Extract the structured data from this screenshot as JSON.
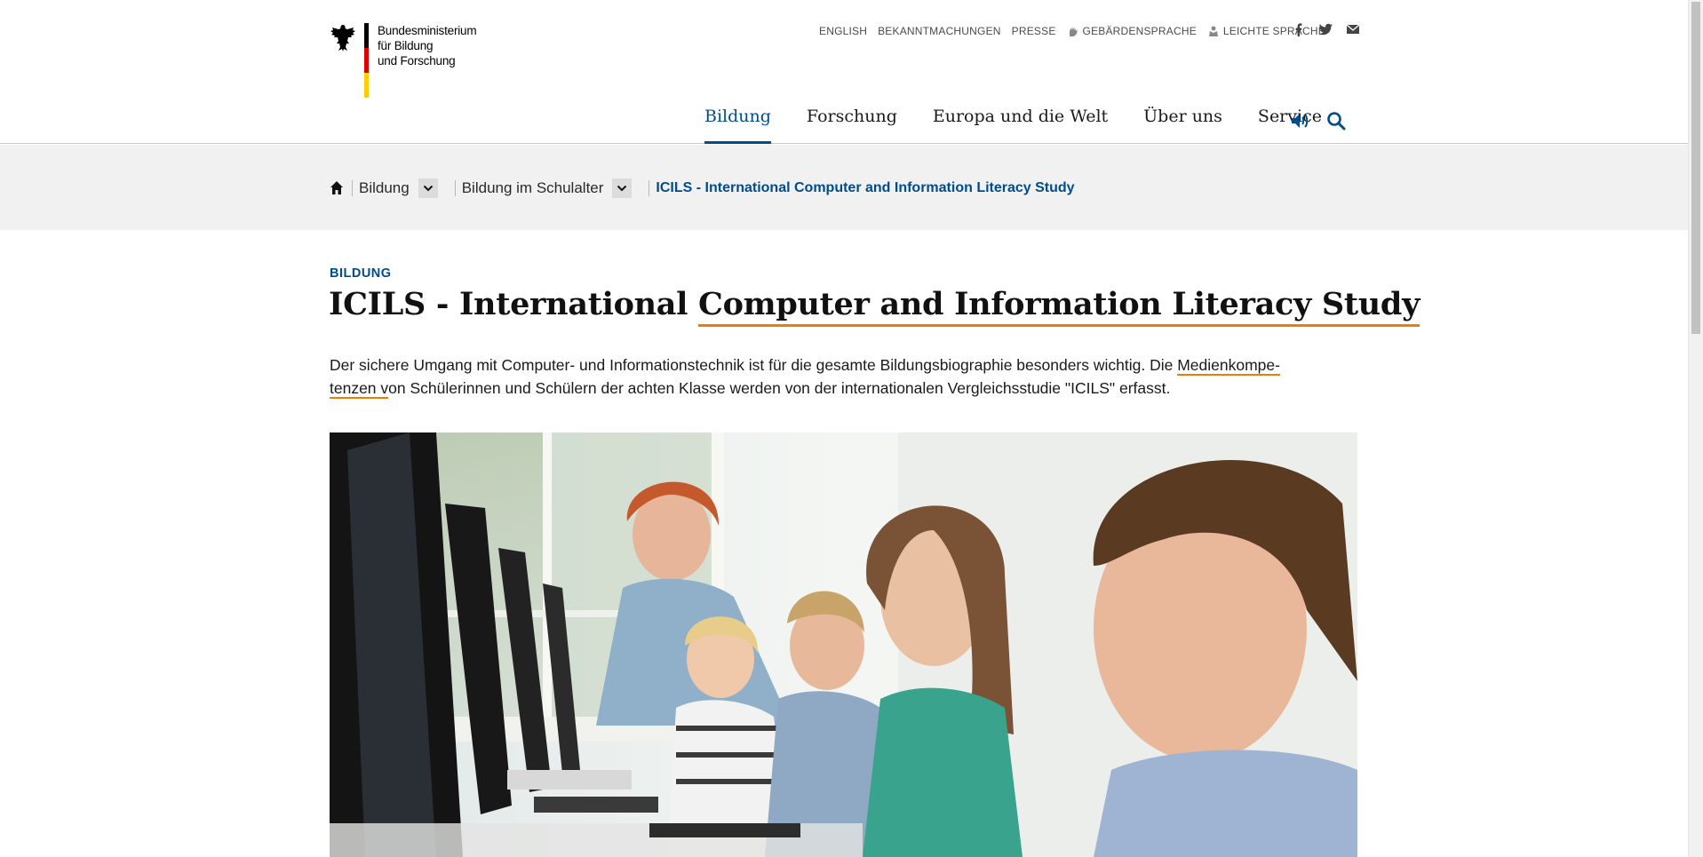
{
  "header": {
    "logo": {
      "lines": [
        "Bundesministerium",
        "für Bildung",
        "und Forschung"
      ]
    },
    "meta_nav": [
      {
        "label": "ENGLISH",
        "icon": ""
      },
      {
        "label": "BEKANNTMACHUNGEN",
        "icon": ""
      },
      {
        "label": "PRESSE",
        "icon": ""
      },
      {
        "label": "GEBÄRDENSPRACHE",
        "icon": "sign-language-icon"
      },
      {
        "label": "LEICHTE SPRACHE",
        "icon": "easy-language-icon"
      }
    ],
    "social": [
      "facebook-icon",
      "twitter-icon",
      "mail-icon"
    ],
    "main_nav": [
      {
        "label": "Bildung",
        "active": true
      },
      {
        "label": "Forschung",
        "active": false
      },
      {
        "label": "Europa und die Welt",
        "active": false
      },
      {
        "label": "Über uns",
        "active": false
      },
      {
        "label": "Service",
        "active": false
      }
    ],
    "tools": [
      "speaker-icon",
      "search-icon"
    ]
  },
  "breadcrumb": {
    "home_icon": "home-icon",
    "items": [
      "Bildung",
      "Bildung im Schulalter"
    ],
    "current": "ICILS - International Computer and Information Literacy Study"
  },
  "article": {
    "kicker": "BILDUNG",
    "title_part1": "ICILS - International ",
    "title_part2": "Computer and Information Literacy Study",
    "lead_part1": "Der sichere Umgang mit Computer- und Informationstechnik ist für die gesamte Bildungsbiographie besonders wichtig. Die ",
    "lead_link_a": "Medienkompe-",
    "lead_link_b": "tenzen v",
    "lead_part2": "on Schülerinnen und Schülern der achten Klasse werden von der internationalen Vergleichsstudie \"ICILS\" erfasst."
  },
  "colors": {
    "accent_blue": "#004c8c",
    "underline_orange": "#f07d00",
    "breadcrumb_bg": "#f1f1f1"
  }
}
